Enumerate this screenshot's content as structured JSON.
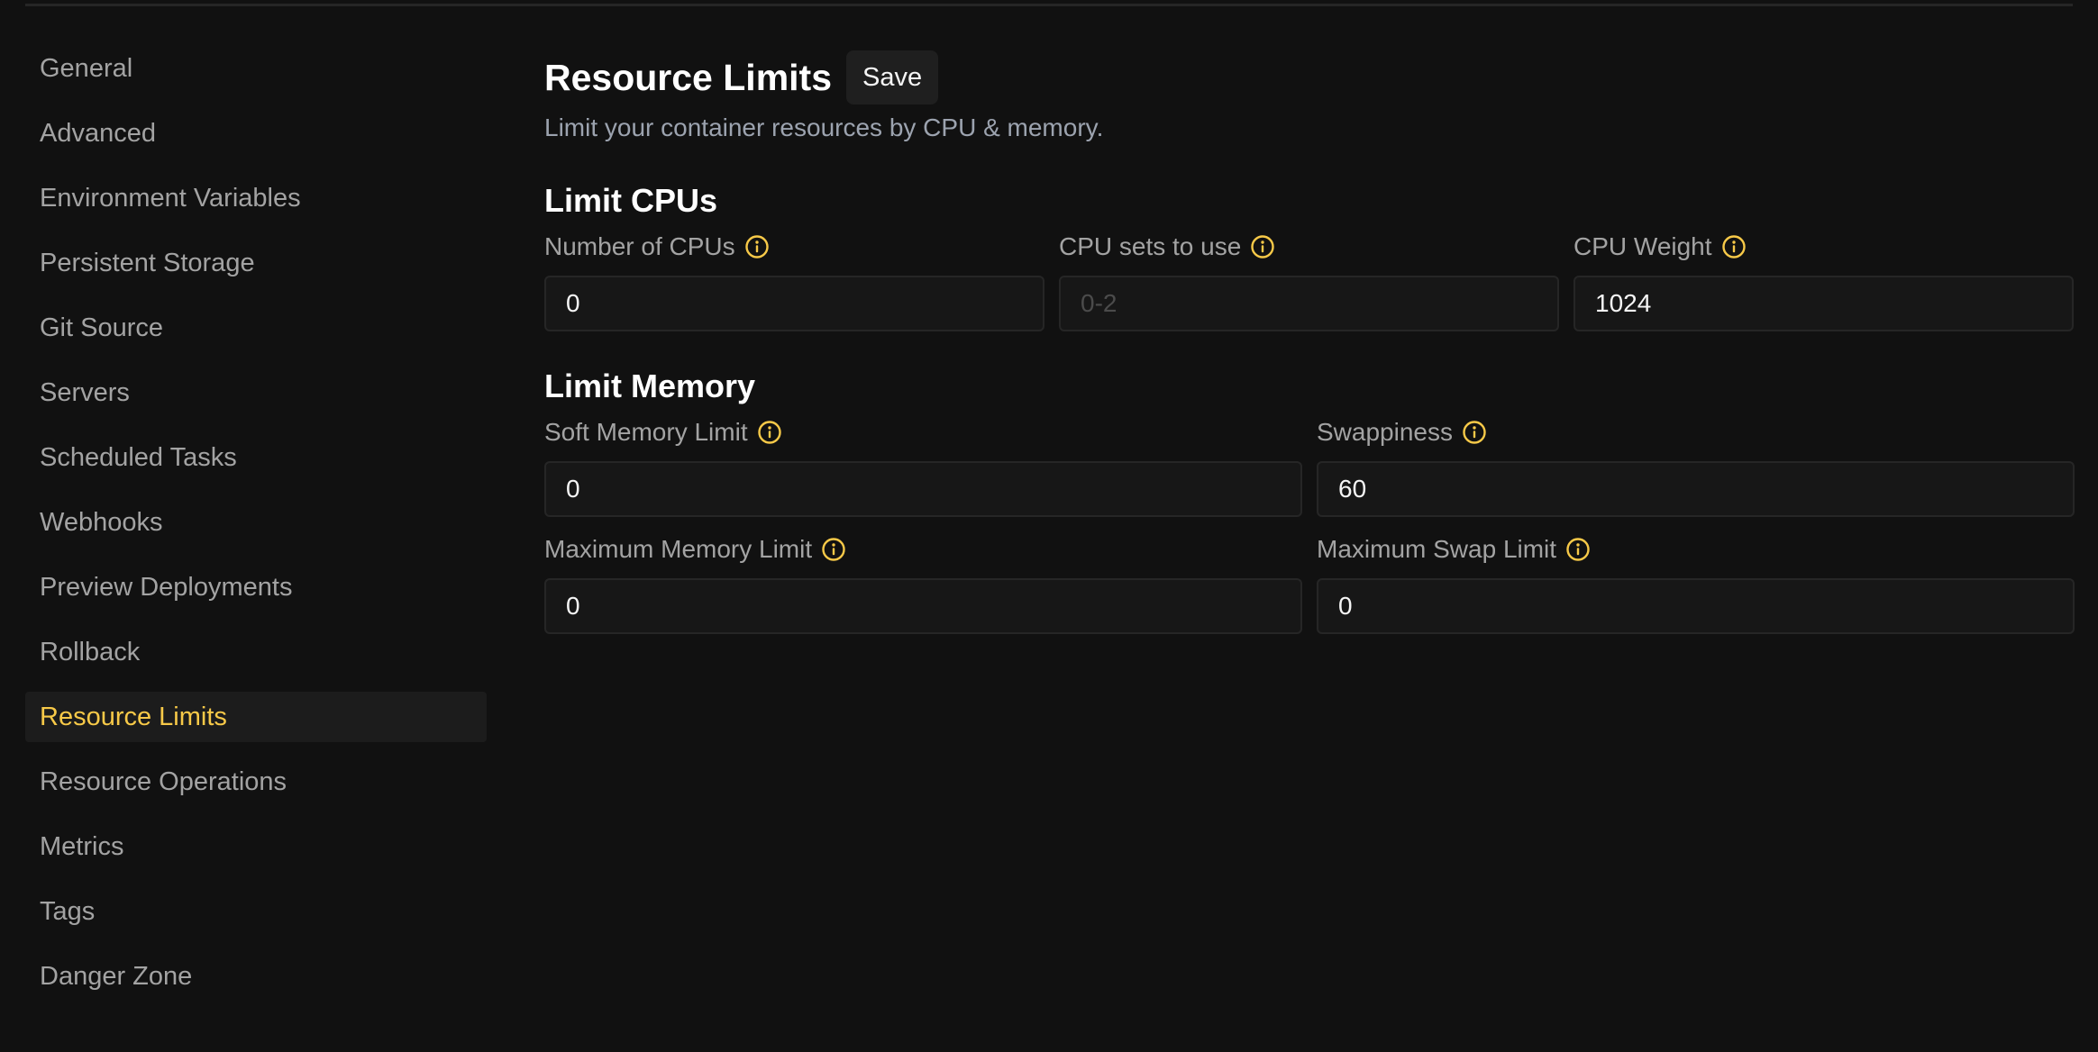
{
  "sidebar": {
    "items": [
      {
        "label": "General"
      },
      {
        "label": "Advanced"
      },
      {
        "label": "Environment Variables"
      },
      {
        "label": "Persistent Storage"
      },
      {
        "label": "Git Source"
      },
      {
        "label": "Servers"
      },
      {
        "label": "Scheduled Tasks"
      },
      {
        "label": "Webhooks"
      },
      {
        "label": "Preview Deployments"
      },
      {
        "label": "Rollback"
      },
      {
        "label": "Resource Limits",
        "active": true
      },
      {
        "label": "Resource Operations"
      },
      {
        "label": "Metrics"
      },
      {
        "label": "Tags"
      },
      {
        "label": "Danger Zone"
      }
    ]
  },
  "main": {
    "title": "Resource Limits",
    "save_label": "Save",
    "subtitle": "Limit your container resources by CPU & memory.",
    "cpu_section": {
      "title": "Limit CPUs",
      "fields": [
        {
          "label": "Number of CPUs",
          "value": "0",
          "placeholder": ""
        },
        {
          "label": "CPU sets to use",
          "value": "",
          "placeholder": "0-2"
        },
        {
          "label": "CPU Weight",
          "value": "1024",
          "placeholder": ""
        }
      ]
    },
    "memory_section": {
      "title": "Limit Memory",
      "fields": [
        {
          "label": "Soft Memory Limit",
          "value": "0",
          "placeholder": ""
        },
        {
          "label": "Swappiness",
          "value": "60",
          "placeholder": ""
        },
        {
          "label": "Maximum Memory Limit",
          "value": "0",
          "placeholder": ""
        },
        {
          "label": "Maximum Swap Limit",
          "value": "0",
          "placeholder": ""
        }
      ]
    }
  },
  "colors": {
    "background": "#111111",
    "accent": "#f7c948",
    "muted_text": "#a3a3a3",
    "input_bg": "#171717",
    "input_border": "#262626"
  },
  "icons": {
    "info": "info-circle-icon"
  }
}
